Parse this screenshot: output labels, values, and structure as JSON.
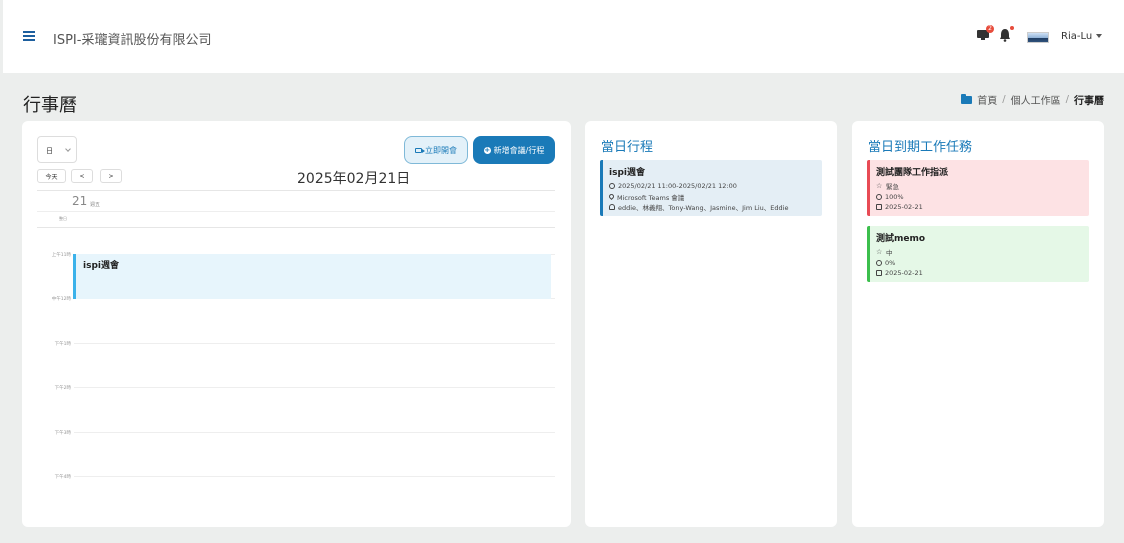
{
  "header": {
    "company": "ISPI-采瓏資訊股份有限公司",
    "notification_count": "2",
    "user_name": "Ria-Lu"
  },
  "page": {
    "title": "行事曆",
    "breadcrumb": [
      "首頁",
      "個人工作區",
      "行事曆"
    ]
  },
  "calendar": {
    "view_select": "日",
    "today_label": "今天",
    "prev_label": "<",
    "next_label": ">",
    "meet_now_label": "立即開會",
    "add_label": "新增會議/行程",
    "current_date": "2025年02月21日",
    "day_number": "21",
    "day_of_week": "週五",
    "allday_label": "整日",
    "hour_labels": [
      "上午11時",
      "中午12時",
      "下午1時",
      "下午2時",
      "下午3時",
      "下午4時"
    ],
    "event": {
      "title": "ispi週會"
    }
  },
  "day_schedule": {
    "title": "當日行程",
    "items": [
      {
        "title": "ispi週會",
        "time": "2025/02/21 11:00-2025/02/21 12:00",
        "location": "Microsoft Teams 會議",
        "attendees": "eddie、林義翔、Tony-Wang、Jasmine、Jim Liu、Eddie"
      }
    ]
  },
  "due_tasks": {
    "title": "當日到期工作任務",
    "items": [
      {
        "title": "測試團隊工作指派",
        "priority": "緊急",
        "progress": "100%",
        "date": "2025-02-21",
        "color": "#e84b55"
      },
      {
        "title": "測試memo",
        "priority": "中",
        "progress": "0%",
        "date": "2025-02-21",
        "color": "#3cbf4d"
      }
    ]
  }
}
